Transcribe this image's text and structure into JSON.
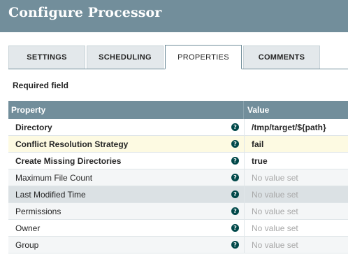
{
  "dialog": {
    "title": "Configure Processor"
  },
  "tabs": [
    {
      "label": "SETTINGS",
      "active": false
    },
    {
      "label": "SCHEDULING",
      "active": false
    },
    {
      "label": "PROPERTIES",
      "active": true
    },
    {
      "label": "COMMENTS",
      "active": false
    }
  ],
  "required_label": "Required field",
  "grid": {
    "columns": {
      "property": "Property",
      "value": "Value"
    },
    "rows": [
      {
        "property": "Directory",
        "value": "/tmp/target/${path}",
        "required": true,
        "value_set": true,
        "state": "normal"
      },
      {
        "property": "Conflict Resolution Strategy",
        "value": "fail",
        "required": true,
        "value_set": true,
        "state": "selected"
      },
      {
        "property": "Create Missing Directories",
        "value": "true",
        "required": true,
        "value_set": true,
        "state": "normal"
      },
      {
        "property": "Maximum File Count",
        "value": "No value set",
        "required": false,
        "value_set": false,
        "state": "alt"
      },
      {
        "property": "Last Modified Time",
        "value": "No value set",
        "required": false,
        "value_set": false,
        "state": "hover"
      },
      {
        "property": "Permissions",
        "value": "No value set",
        "required": false,
        "value_set": false,
        "state": "alt"
      },
      {
        "property": "Owner",
        "value": "No value set",
        "required": false,
        "value_set": false,
        "state": "normal"
      },
      {
        "property": "Group",
        "value": "No value set",
        "required": false,
        "value_set": false,
        "state": "alt"
      }
    ],
    "help_icon": "question-circle-icon"
  },
  "colors": {
    "header_bg": "#728e9b",
    "selected_row": "#fdfae2",
    "help_icon": "#004849"
  }
}
